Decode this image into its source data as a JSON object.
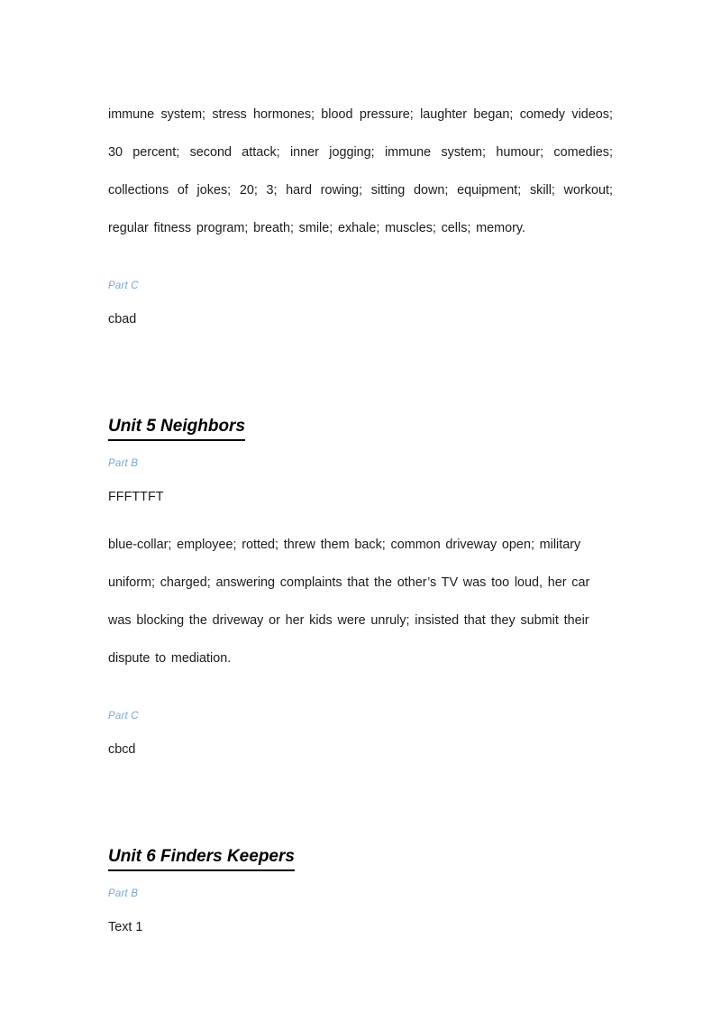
{
  "document": {
    "page_background": "#ffffff",
    "text_color": "#1c1c1c",
    "label_color": "#77a8d4",
    "heading_color": "#000000"
  },
  "sections": [
    {
      "id": "unit4-continuation",
      "keywords_paragraph": "immune system;  stress hormones;  blood pressure;  laughter began;  comedy videos;  30 percent;  second attack;  inner jogging;  immune system;  humour;  comedies;  collections of jokes;  20;  3;  hard rowing;  sitting down;  equipment;  skill;  workout;  regular fitness program;  breath;  smile;  exhale;  muscles;  cells;  memory.",
      "part_c_label": "Part C",
      "part_c_answer": "cbad"
    },
    {
      "id": "unit5",
      "heading": "Unit 5 Neighbors",
      "part_b_label": "Part B",
      "part_b_tf_answer": "FFFTTFT",
      "part_b_paragraph": "blue-collar;  employee;  rotted;  threw them back;  common driveway open;  military uniform;  charged;  answering complaints that the other’s TV was too loud, her car was blocking the driveway or her kids were unruly;  insisted that they submit their dispute to mediation.",
      "part_c_label": "Part C",
      "part_c_answer": "cbcd"
    },
    {
      "id": "unit6",
      "heading": "Unit 6 Finders Keepers",
      "part_b_label": "Part B",
      "part_b_text_marker": "Text 1"
    }
  ]
}
